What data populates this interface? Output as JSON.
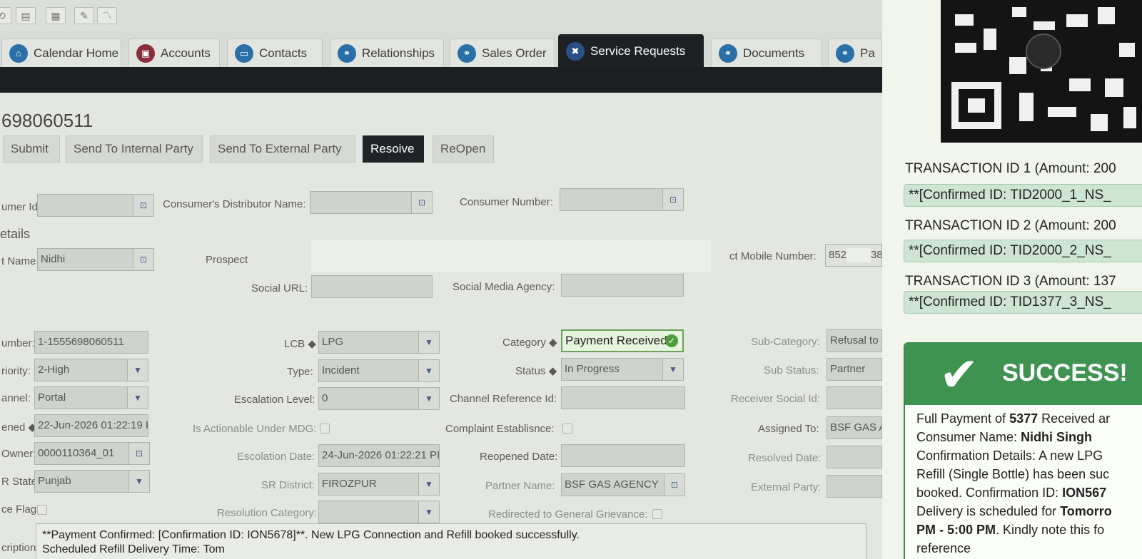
{
  "tabs": [
    {
      "label": "Calendar Home",
      "icon": "home-icon"
    },
    {
      "label": "Accounts",
      "icon": "accounts-icon"
    },
    {
      "label": "Contacts",
      "icon": "contacts-icon"
    },
    {
      "label": "Relationships",
      "icon": "relationships-icon"
    },
    {
      "label": "Sales Order",
      "icon": "sales-order-icon"
    },
    {
      "label": "Service Requests",
      "icon": "tools-icon"
    },
    {
      "label": "Documents",
      "icon": "documents-icon"
    },
    {
      "label": "Pa",
      "icon": "partial-tab-icon"
    }
  ],
  "record_id": "698060511",
  "actions": {
    "submit": "Submit",
    "send_internal": "Send To Internal Party",
    "send_external": "Send To External Party",
    "resolve": "Resoive",
    "reopen": "ReOpen"
  },
  "consumer": {
    "id_label": "umer Id:",
    "distributor_label": "Consumer's Distributor Name:",
    "number_label": "Consumer Number:"
  },
  "details": {
    "section_title": "etails",
    "name_label": "t Name:",
    "name_value": "Nidhi",
    "prospect_label": "Prospect",
    "mobile_label": "ct Mobile Number:",
    "mobile_value": "852",
    "mobile_value_end": "38",
    "social_url_label": "Social URL:",
    "social_agency_label": "Social Media Agency:"
  },
  "sr": {
    "number_label": "umber:",
    "number_value": "1-1555698060511",
    "priority_label": "riority:",
    "priority_value": "2-High",
    "channel_label": "annel:",
    "channel_value": "Portal",
    "opened_label": "ened ◆",
    "opened_value": "22-Jun-2026 01:22:19 PI",
    "owner_label": "Owner:",
    "owner_value": "0000110364_01",
    "state_label": "R State:",
    "state_value": "Punjab",
    "flag_label": "ce Flag:",
    "lcb_label": "LCB ◆",
    "lcb_value": "LPG",
    "type_label": "Type:",
    "type_value": "Incident",
    "escalation_level_label": "Escalation Level:",
    "escalation_level_value": "0",
    "actionable_label": "Is Actionable Under MDG:",
    "escalation_date_label": "Escolation Date:",
    "escalation_date_value": "24-Jun-2026 01:22:21 PI",
    "district_label": "SR District:",
    "district_value": "FIROZPUR",
    "resolution_label": "Resolution Category:",
    "category_label": "Category ◆",
    "category_value": "Payment Received",
    "status_label": "Status ◆",
    "status_value": "In Progress",
    "channel_ref_label": "Channel Reference Id:",
    "complaint_label": "Complaint Establisnce:",
    "reopened_label": "Reopened Date:",
    "partner_label": "Partner Name:",
    "partner_value": "BSF GAS AGENCY",
    "redirected_label": "Redirected to General Grievance:",
    "subcategory_label": "Sub-Category:",
    "subcategory_value": "Refusal to",
    "substatus_label": "Sub Status:",
    "substatus_value": "Partner",
    "receiver_label": "Receiver Social Id:",
    "assigned_label": "Assigned To:",
    "assigned_value": "BSF GAS A",
    "resolved_label": "Resolved Date:",
    "external_label": "External Party:"
  },
  "description": {
    "label": "cription:",
    "line1": "**Payment Confirmed: [Confirmation ID: ION5678]**. New LPG Connection and Refill booked successfully.",
    "line2": "Scheduled Refill Delivery Time: Tom"
  },
  "phone": {
    "tx1_title": "TRANSACTION ID 1 (Amount: 200",
    "tx1_conf": "**[Confirmed ID: TID2000_1_NS_",
    "tx2_title": "TRANSACTION ID 2 (Amount: 200",
    "tx2_conf": "**[Confirmed ID: TID2000_2_NS_",
    "tx3_title": "TRANSACTION ID 3 (Amount: 137",
    "tx3_conf": "**[Confirmed ID: TID1377_3_NS_",
    "success_title": "SUCCESS!",
    "body_p1": "Full Payment of ",
    "body_amount": "5377",
    "body_p2": " Received ar",
    "body_name_label": "Consumer Name: ",
    "body_name": "Nidhi Singh",
    "body_conf": "Confirmation Details: A new LPG",
    "body_conf2": "Refill (Single Bottle) has been suc",
    "body_conf3": "booked. Confirmation ID: ",
    "body_conf_id": "ION567",
    "body_del": "Delivery is scheduled for ",
    "body_del_bold": "Tomorro",
    "body_pm": "PM - 5:00 PM",
    "body_pm_rest": ". Kindly note this fo",
    "body_ref": "reference"
  },
  "colors": {
    "dark_bar": "#1c1f22",
    "tab_icon": "#2a6fa8",
    "success_green": "#3e9351",
    "category_border": "#6aa05a"
  }
}
